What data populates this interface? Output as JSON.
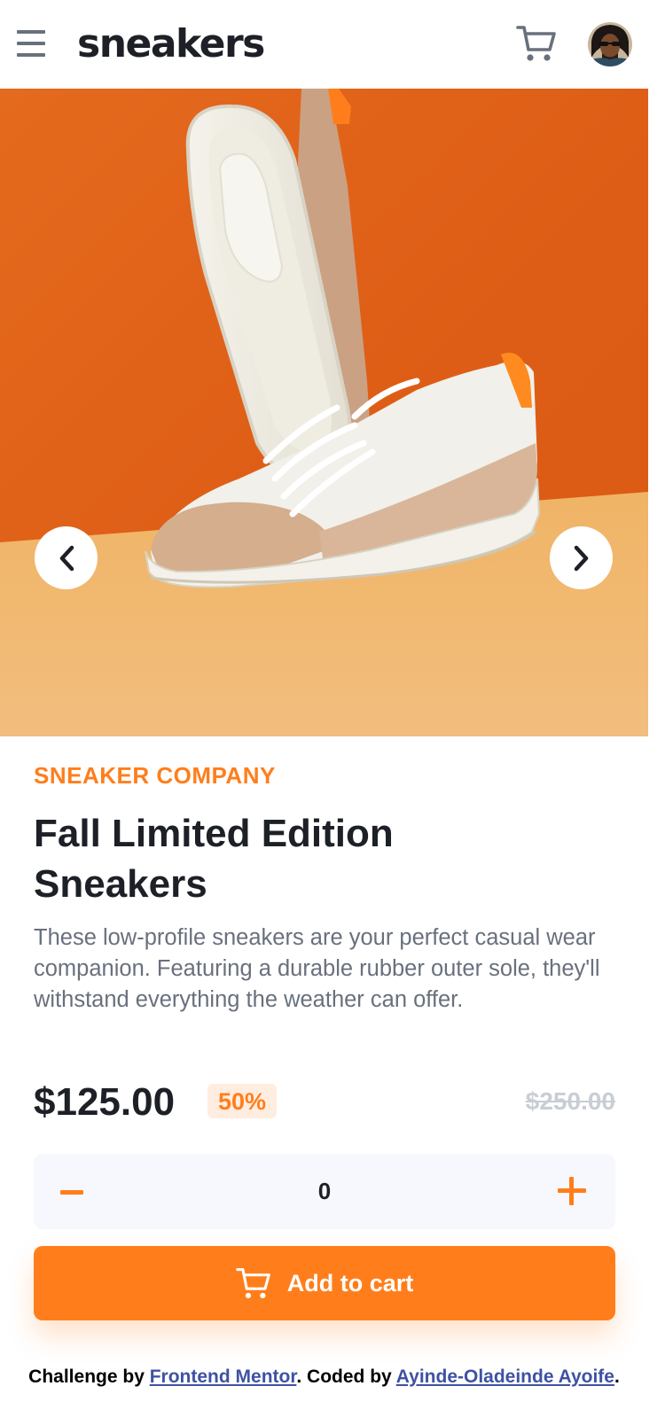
{
  "header": {
    "menu_icon": "hamburger-menu-icon",
    "logo": "sneakers",
    "cart_icon": "cart-icon",
    "avatar_icon": "user-avatar"
  },
  "gallery": {
    "prev_icon": "chevron-left-icon",
    "next_icon": "chevron-right-icon",
    "colors": {
      "background_top": "#e0601a",
      "floor": "#f0b870"
    }
  },
  "product": {
    "company": "SNEAKER COMPANY",
    "title": "Fall Limited Edition Sneakers",
    "description": "These low-profile sneakers are your perfect casual wear companion. Featuring a durable rubber outer sole, they'll withstand everything the weather can offer.",
    "price": "$125.00",
    "discount": "50%",
    "old_price": "$250.00"
  },
  "quantity": {
    "minus_icon": "minus-icon",
    "value": "0",
    "plus_icon": "plus-icon"
  },
  "add_to_cart": {
    "label": "Add to cart",
    "icon": "cart-icon"
  },
  "attribution": {
    "prefix": "Challenge by ",
    "link1": "Frontend Mentor",
    "middle": ". Coded by ",
    "link2": "Ayinde-Oladeinde Ayoife",
    "suffix": "."
  },
  "colors": {
    "accent": "#ff7e1b",
    "accent_pale": "#ffede0",
    "text_dark": "#1d2026",
    "text_grey": "#69707d",
    "muted": "#c9cdd4",
    "field_bg": "#f7f8fd"
  }
}
